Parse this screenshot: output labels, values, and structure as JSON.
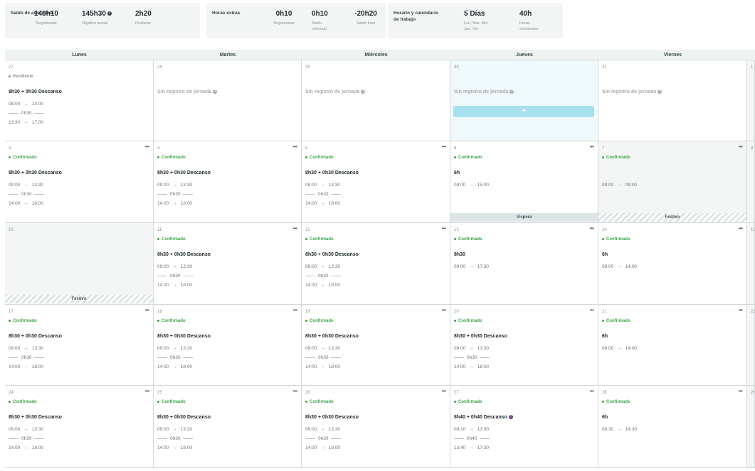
{
  "summary": {
    "attendance": {
      "title": "Saldo de asistencia",
      "metrics": [
        {
          "value": "143h10",
          "label": "Registradas"
        },
        {
          "value": "145h30",
          "label": "Objetivo actual",
          "info": "i"
        },
        {
          "value": "2h20",
          "label": "Restante"
        }
      ]
    },
    "extra": {
      "title": "Horas extras",
      "metrics": [
        {
          "value": "0h10",
          "label": "Registradas"
        },
        {
          "value": "0h10",
          "label": "Saldo mensual"
        },
        {
          "value": "-20h20",
          "label": "Saldo total"
        }
      ]
    },
    "schedule": {
      "title": "Horario y calendario de trabajo",
      "metrics": [
        {
          "value": "5 Días",
          "label": "Lun, Mar, Mié, Jue, Vie"
        },
        {
          "value": "40h",
          "label": "Horas semanales"
        }
      ]
    }
  },
  "weekdays": [
    "Lunes",
    "Martes",
    "Miércoles",
    "Jueves",
    "Viernes"
  ],
  "add_label": "+",
  "menu_glyph": "•••",
  "arrow": "→",
  "info_glyph": "?",
  "alert_glyph": "!",
  "labels": {
    "pending": "Pendiente",
    "confirmed": "Confirmado",
    "no_record": "Sin registro de jornada",
    "vispera": "Víspera",
    "festivo": "Festivo"
  },
  "weeks": [
    [
      {
        "num": "27",
        "status": "pending",
        "summary": "8h30 + 0h30 Descanso",
        "rows": [
          [
            "08:00",
            "13:00"
          ],
          [
            "break",
            "0h30"
          ],
          [
            "13:30",
            "17:00"
          ]
        ]
      },
      {
        "num": "28",
        "no_record": true
      },
      {
        "num": "29",
        "no_record": true
      },
      {
        "num": "30",
        "no_record": true,
        "today": true,
        "add": true
      },
      {
        "num": "31",
        "no_record": true
      },
      {
        "num": "1",
        "weekend": true
      }
    ],
    [
      {
        "num": "3",
        "status": "confirmed",
        "menu": true,
        "summary": "8h30 + 0h30 Descanso",
        "rows": [
          [
            "09:00",
            "13:30"
          ],
          [
            "break",
            "0h30"
          ],
          [
            "14:00",
            "18:00"
          ]
        ]
      },
      {
        "num": "4",
        "status": "confirmed",
        "menu": true,
        "summary": "8h30 + 0h30 Descanso",
        "rows": [
          [
            "09:00",
            "13:30"
          ],
          [
            "break",
            "0h30"
          ],
          [
            "14:00",
            "18:00"
          ]
        ]
      },
      {
        "num": "5",
        "status": "confirmed",
        "menu": true,
        "summary": "8h30 + 0h30 Descanso",
        "rows": [
          [
            "09:00",
            "13:30"
          ],
          [
            "break",
            "0h30"
          ],
          [
            "14:00",
            "18:00"
          ]
        ]
      },
      {
        "num": "6",
        "status": "confirmed",
        "menu": true,
        "summary": "6h",
        "rows": [
          [
            "09:00",
            "15:00"
          ]
        ],
        "footer": "vispera"
      },
      {
        "num": "7",
        "status": "confirmed",
        "menu": true,
        "holiday": true,
        "rows": [
          [
            "09:00",
            "09:00"
          ]
        ],
        "footer": "festivo"
      },
      {
        "num": "8",
        "weekend": true
      }
    ],
    [
      {
        "num": "10",
        "holiday": true,
        "footer": "festivo"
      },
      {
        "num": "11",
        "status": "confirmed",
        "menu": true,
        "summary": "8h30 + 0h30 Descanso",
        "rows": [
          [
            "09:00",
            "13:30"
          ],
          [
            "break",
            "0h30"
          ],
          [
            "14:00",
            "18:00"
          ]
        ]
      },
      {
        "num": "12",
        "status": "confirmed",
        "menu": true,
        "summary": "8h30 + 0h30 Descanso",
        "rows": [
          [
            "09:00",
            "13:30"
          ],
          [
            "break",
            "0h30"
          ],
          [
            "14:00",
            "18:00"
          ]
        ]
      },
      {
        "num": "13",
        "status": "confirmed",
        "menu": true,
        "summary": "8h30",
        "rows": [
          [
            "09:00",
            "17:30"
          ]
        ]
      },
      {
        "num": "14",
        "status": "confirmed",
        "menu": true,
        "summary": "6h",
        "rows": [
          [
            "08:00",
            "14:00"
          ]
        ]
      },
      {
        "num": "15",
        "weekend": true
      }
    ],
    [
      {
        "num": "17",
        "status": "confirmed",
        "menu": true,
        "summary": "8h30 + 0h30 Descanso",
        "rows": [
          [
            "09:00",
            "13:30"
          ],
          [
            "break",
            "0h30"
          ],
          [
            "14:00",
            "18:00"
          ]
        ]
      },
      {
        "num": "18",
        "status": "confirmed",
        "menu": true,
        "summary": "8h30 + 0h30 Descanso",
        "rows": [
          [
            "09:00",
            "13:30"
          ],
          [
            "break",
            "0h30"
          ],
          [
            "14:00",
            "18:00"
          ]
        ]
      },
      {
        "num": "19",
        "status": "confirmed",
        "menu": true,
        "summary": "8h30 + 0h30 Descanso",
        "rows": [
          [
            "09:00",
            "13:30"
          ],
          [
            "break",
            "0h30"
          ],
          [
            "14:00",
            "18:00"
          ]
        ]
      },
      {
        "num": "20",
        "status": "confirmed",
        "menu": true,
        "summary": "8h30 + 0h30 Descanso",
        "rows": [
          [
            "09:00",
            "13:30"
          ],
          [
            "break",
            "0h30"
          ],
          [
            "14:00",
            "18:00"
          ]
        ]
      },
      {
        "num": "21",
        "status": "confirmed",
        "menu": true,
        "summary": "6h",
        "rows": [
          [
            "08:00",
            "14:00"
          ]
        ]
      },
      {
        "num": "22",
        "weekend": true
      }
    ],
    [
      {
        "num": "24",
        "status": "confirmed",
        "menu": true,
        "summary": "8h30 + 0h30 Descanso",
        "rows": [
          [
            "09:00",
            "13:30"
          ],
          [
            "break",
            "0h30"
          ],
          [
            "14:00",
            "18:00"
          ]
        ]
      },
      {
        "num": "25",
        "status": "confirmed",
        "menu": true,
        "summary": "8h30 + 0h30 Descanso",
        "rows": [
          [
            "09:00",
            "13:30"
          ],
          [
            "break",
            "0h30"
          ],
          [
            "14:00",
            "18:00"
          ]
        ]
      },
      {
        "num": "26",
        "status": "confirmed",
        "menu": true,
        "summary": "8h30 + 0h30 Descanso",
        "rows": [
          [
            "09:00",
            "13:30"
          ],
          [
            "break",
            "0h30"
          ],
          [
            "14:00",
            "18:00"
          ]
        ]
      },
      {
        "num": "27",
        "status": "confirmed",
        "menu": true,
        "summary": "8h40 + 0h40 Descanso",
        "alert": true,
        "rows": [
          [
            "08:10",
            "13:00"
          ],
          [
            "break",
            "0h40"
          ],
          [
            "13:40",
            "17:30"
          ]
        ]
      },
      {
        "num": "28",
        "status": "confirmed",
        "menu": true,
        "summary": "6h",
        "rows": [
          [
            "08:30",
            "14:30"
          ]
        ]
      },
      {
        "num": "29",
        "weekend": true
      }
    ]
  ]
}
